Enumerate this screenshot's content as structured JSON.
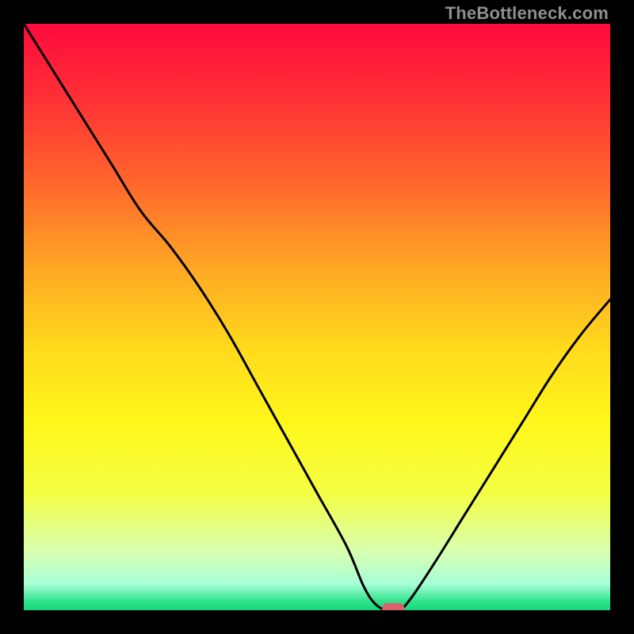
{
  "watermark": "TheBottleneck.com",
  "chart_data": {
    "type": "line",
    "title": "",
    "xlabel": "",
    "ylabel": "",
    "xlim": [
      0,
      100
    ],
    "ylim": [
      0,
      100
    ],
    "series": [
      {
        "name": "bottleneck-curve",
        "x": [
          0,
          5,
          10,
          15,
          20,
          25,
          30,
          35,
          40,
          45,
          50,
          55,
          58,
          60,
          62,
          64,
          66,
          70,
          75,
          80,
          85,
          90,
          95,
          100
        ],
        "y": [
          100,
          92,
          84,
          76,
          68,
          62,
          55,
          47,
          38,
          29,
          20,
          11,
          4,
          1,
          0,
          0,
          2,
          8,
          16,
          24,
          32,
          40,
          47,
          53
        ]
      }
    ],
    "marker": {
      "x": 63,
      "y": 0,
      "label": "optimal-point"
    },
    "gradient_stops": [
      {
        "offset": 0.0,
        "color": "#ff0a3c"
      },
      {
        "offset": 0.12,
        "color": "#ff2e36"
      },
      {
        "offset": 0.28,
        "color": "#ff6a2c"
      },
      {
        "offset": 0.42,
        "color": "#ffa924"
      },
      {
        "offset": 0.55,
        "color": "#ffd91c"
      },
      {
        "offset": 0.68,
        "color": "#fff71a"
      },
      {
        "offset": 0.8,
        "color": "#f4ff44"
      },
      {
        "offset": 0.9,
        "color": "#d8ffb0"
      },
      {
        "offset": 0.955,
        "color": "#a8ffd8"
      },
      {
        "offset": 0.985,
        "color": "#2fe28b"
      },
      {
        "offset": 1.0,
        "color": "#18d878"
      }
    ]
  }
}
